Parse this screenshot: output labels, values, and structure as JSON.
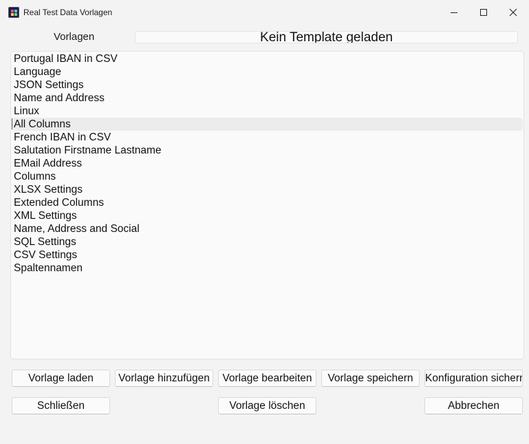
{
  "window": {
    "title": "Real Test Data Vorlagen"
  },
  "header": {
    "label": "Vorlagen",
    "status": "Kein Template geladen"
  },
  "templates": {
    "items": [
      "Portugal IBAN in CSV",
      "Language",
      "JSON Settings",
      "Name and Address",
      "Linux",
      "All Columns",
      "French IBAN in CSV",
      "Salutation Firstname Lastname",
      "EMail Address",
      "Columns",
      "XLSX Settings",
      "Extended Columns",
      "XML Settings",
      "Name, Address and Social",
      "SQL Settings",
      "CSV Settings",
      "Spaltennamen"
    ],
    "selected_index": 5
  },
  "buttons": {
    "load": "Vorlage laden",
    "add": "Vorlage hinzufügen",
    "edit": "Vorlage bearbeiten",
    "save": "Vorlage speichern",
    "backup": "Konfiguration sichern",
    "close": "Schließen",
    "delete": "Vorlage löschen",
    "cancel": "Abbrechen"
  },
  "colors": {
    "window_bg": "#f3f3f3",
    "list_bg": "#fafafa",
    "selection_bg": "#ececec"
  }
}
